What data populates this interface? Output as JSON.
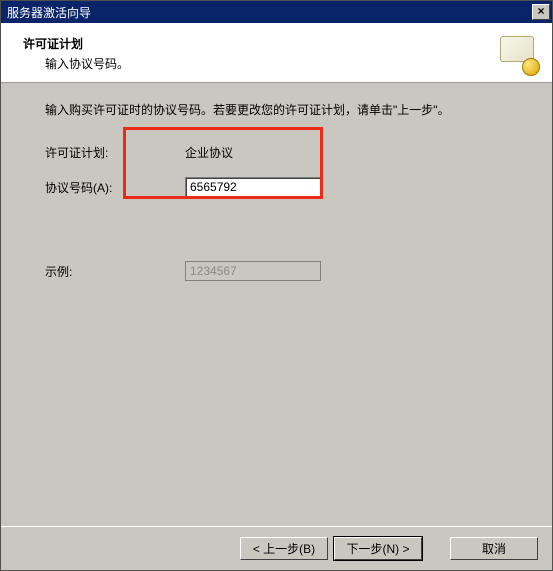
{
  "window": {
    "title": "服务器激活向导"
  },
  "header": {
    "title": "许可证计划",
    "subtitle": "输入协议号码。"
  },
  "content": {
    "instruction": "输入购买许可证时的协议号码。若要更改您的许可证计划，请单击\"上一步\"。",
    "plan_label": "许可证计划:",
    "plan_value": "企业协议",
    "agreement_label": "协议号码(A):",
    "agreement_value": "6565792",
    "example_label": "示例:",
    "example_value": "1234567"
  },
  "footer": {
    "back": "< 上一步(B)",
    "next": "下一步(N) >",
    "cancel": "取消"
  }
}
